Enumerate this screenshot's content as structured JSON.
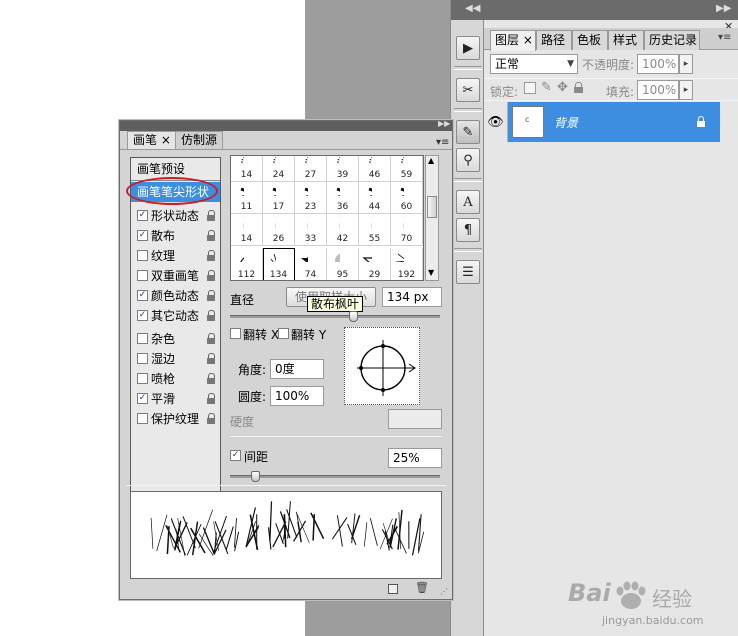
{
  "colors": {
    "accent_blue": "#3d8ee0",
    "highlight_circle": "#cc1e1e",
    "panel_bg": "#d4d4d4"
  },
  "layers_panel": {
    "tabs": [
      {
        "label": "图层",
        "close": "×"
      },
      {
        "label": "路径"
      },
      {
        "label": "色板"
      },
      {
        "label": "样式"
      },
      {
        "label": "历史记录"
      }
    ],
    "blend_mode": "正常",
    "opacity_label": "不透明度:",
    "opacity_value": "100%",
    "lock_label": "锁定:",
    "fill_label": "填充:",
    "fill_value": "100%",
    "layer_name": "背景"
  },
  "brush_panel": {
    "tabs": [
      {
        "label": "画笔",
        "close": "×"
      },
      {
        "label": "仿制源"
      }
    ],
    "presets_label": "画笔预设",
    "tip_shape_label": "画笔笔尖形状",
    "options": [
      {
        "label": "形状动态",
        "checked": true
      },
      {
        "label": "散布",
        "checked": true
      },
      {
        "label": "纹理",
        "checked": false
      },
      {
        "label": "双重画笔",
        "checked": false
      },
      {
        "label": "颜色动态",
        "checked": true
      },
      {
        "label": "其它动态",
        "checked": true
      },
      {
        "label": "杂色",
        "checked": false
      },
      {
        "label": "湿边",
        "checked": false
      },
      {
        "label": "喷枪",
        "checked": false
      },
      {
        "label": "平滑",
        "checked": true
      },
      {
        "label": "保护纹理",
        "checked": false
      }
    ],
    "check_mark": "✓",
    "brush_sizes": [
      [
        "14",
        "24",
        "27",
        "39",
        "46",
        "59"
      ],
      [
        "11",
        "17",
        "23",
        "36",
        "44",
        "60"
      ],
      [
        "14",
        "26",
        "33",
        "42",
        "55",
        "70"
      ],
      [
        "112",
        "134",
        "74",
        "95",
        "29",
        "192"
      ]
    ],
    "diameter_label": "直径",
    "use_sample_button": "使用取样大小",
    "diameter_value": "134 px",
    "tooltip": "散布枫叶",
    "flip_x_label": "翻转 X",
    "flip_y_label": "翻转 Y",
    "angle_label": "角度:",
    "angle_value": "0度",
    "roundness_label": "圆度:",
    "roundness_value": "100%",
    "hardness_label": "硬度",
    "spacing_label": "间距",
    "spacing_checked": true,
    "spacing_value": "25%"
  },
  "watermark": {
    "brand": "Bai",
    "brand_suffix": "经验",
    "url": "jingyan.baidu.com"
  }
}
